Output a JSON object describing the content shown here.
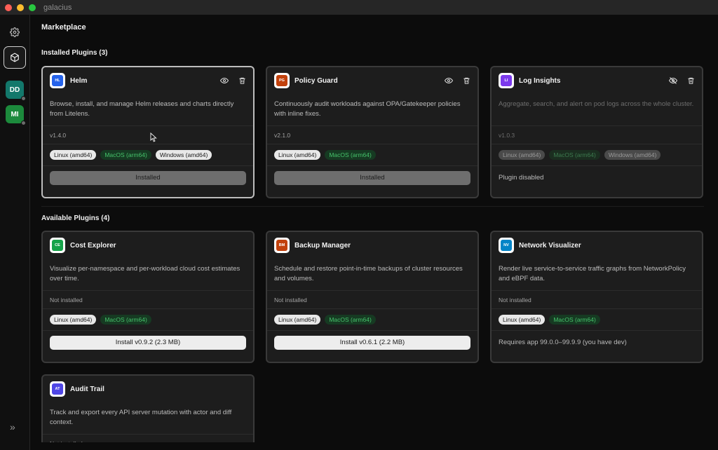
{
  "app": {
    "title": "galacius"
  },
  "sidebar": {
    "avatars": [
      {
        "initials": "DD",
        "color": "#13786b"
      },
      {
        "initials": "MI",
        "color": "#1c8a3c"
      }
    ]
  },
  "page": {
    "title": "Marketplace"
  },
  "installed": {
    "title": "Installed Plugins (3)",
    "plugins": [
      {
        "icon_text": "HL",
        "icon_color": "#2563eb",
        "name": "Helm",
        "description": "Browse, install, and manage Helm releases and charts directly from Litelens.",
        "version": "v1.4.0",
        "tags": [
          "Linux (amd64)",
          "MacOS (arm64)",
          "Windows (amd64)"
        ],
        "visibility_icon": "eye-icon",
        "button_label": "Installed"
      },
      {
        "icon_text": "PG",
        "icon_color": "#c2410c",
        "name": "Policy Guard",
        "description": "Continuously audit workloads against OPA/Gatekeeper policies with inline fixes.",
        "version": "v2.1.0",
        "tags": [
          "Linux (amd64)",
          "MacOS (arm64)"
        ],
        "visibility_icon": "eye-icon",
        "button_label": "Installed"
      },
      {
        "icon_text": "LI",
        "icon_color": "#7c3aed",
        "name": "Log Insights",
        "description": "Aggregate, search, and alert on pod logs across the whole cluster.",
        "version": "v1.0.3",
        "tags": [
          "Linux (amd64)",
          "MacOS (arm64)",
          "Windows (amd64)"
        ],
        "visibility_icon": "eye-off-icon",
        "status_note": "Plugin disabled"
      }
    ]
  },
  "available": {
    "title": "Available Plugins (4)",
    "plugins": [
      {
        "icon_text": "CE",
        "icon_color": "#16a34a",
        "name": "Cost Explorer",
        "description": "Visualize per-namespace and per-workload cloud cost estimates over time.",
        "version": "Not installed",
        "tags": [
          "Linux (amd64)",
          "MacOS (arm64)"
        ],
        "button_label": "Install v0.9.2 (2.3 MB)"
      },
      {
        "icon_text": "BM",
        "icon_color": "#c2410c",
        "name": "Backup Manager",
        "description": "Schedule and restore point-in-time backups of cluster resources and volumes.",
        "version": "Not installed",
        "tags": [
          "Linux (amd64)",
          "MacOS (arm64)"
        ],
        "button_label": "Install v0.6.1 (2.2 MB)"
      },
      {
        "icon_text": "NV",
        "icon_color": "#0284c7",
        "name": "Network Visualizer",
        "description": "Render live service-to-service traffic graphs from NetworkPolicy and eBPF data.",
        "version": "Not installed",
        "tags": [
          "Linux (amd64)",
          "MacOS (arm64)"
        ],
        "status_note": "Requires app 99.0.0–99.9.9 (you have dev)"
      },
      {
        "icon_text": "AT",
        "icon_color": "#4f46e5",
        "name": "Audit Trail",
        "description": "Track and export every API server mutation with actor and diff context.",
        "version": "Not installed"
      }
    ]
  }
}
